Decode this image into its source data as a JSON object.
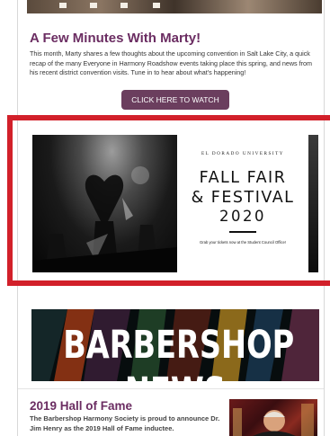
{
  "section1": {
    "title": "A Few Minutes With Marty!",
    "body": "This month, Marty shares a few thoughts about the upcoming convention in Salt Lake City, a quick recap of the many Everyone in Harmony Roadshow events taking place this spring, and news from his recent district convention visits. Tune in to hear about what's happening!",
    "button_label": "CLICK HERE TO WATCH"
  },
  "fair_banner": {
    "university": "EL DORADO UNIVERSITY",
    "title_line1": "FALL FAIR",
    "title_line2": "& FESTIVAL",
    "year": "2020",
    "note": "Grab your tickets now at the Student Council Office!"
  },
  "news_banner": {
    "text": "BARBERSHOP NEWS"
  },
  "hall_of_fame": {
    "title": "2019 Hall of Fame",
    "body": "The Barbershop Harmony Society is proud to announce Dr. Jim Henry as the 2019 Hall of Fame inductee."
  },
  "colors": {
    "heading": "#6b2d62",
    "button": "#6b3e5e",
    "highlight_frame": "#d2202a"
  }
}
